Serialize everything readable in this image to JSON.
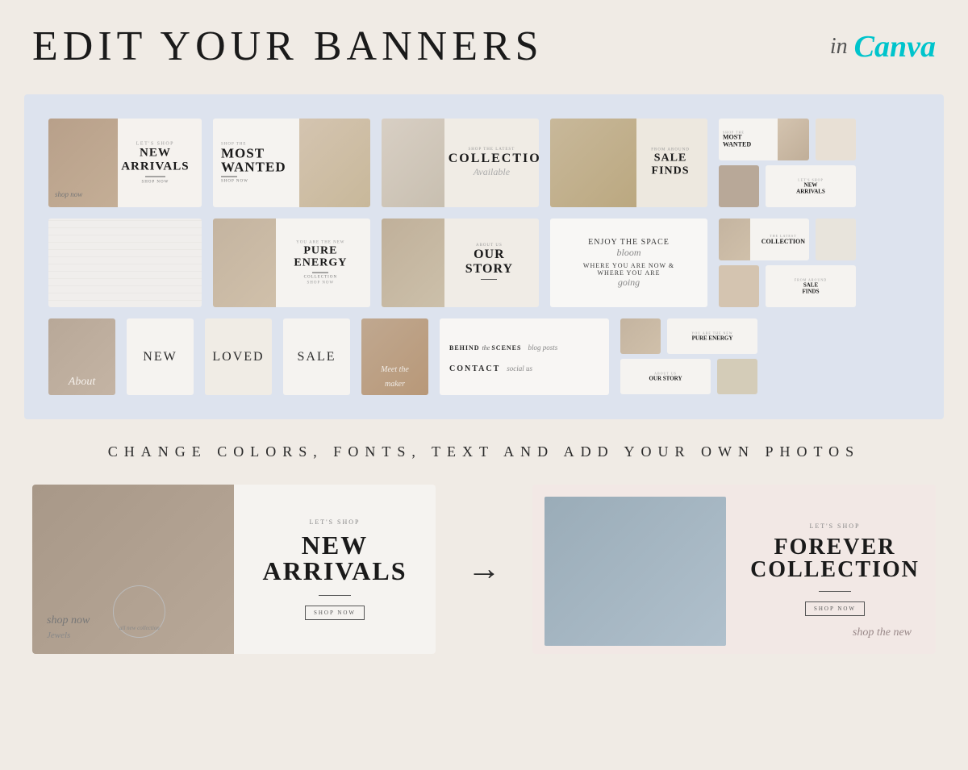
{
  "header": {
    "title": "EDIT YOUR BANNERS",
    "in_text": "in",
    "canva_text": "Canva"
  },
  "grid": {
    "row1": [
      {
        "id": "new-arrivals",
        "type": "wide",
        "text": "NEW ARRIVALS",
        "small": "LET'S SHOP",
        "sub": "SHOP NOW",
        "bg": "warm",
        "hasPhoto": true
      },
      {
        "id": "most-wanted",
        "type": "wide",
        "text": "MOST WANTED",
        "small": "SHOP THE",
        "sub": "SHOP NOW",
        "bg": "light",
        "hasPhoto": true
      },
      {
        "id": "collection",
        "type": "wide",
        "text": "COLLECTION",
        "small": "SHOP THE LATEST",
        "sub": "",
        "bg": "beige",
        "hasPhoto": true
      },
      {
        "id": "sale-finds",
        "type": "wide",
        "text": "SALE FINDS",
        "small": "FROM AROUND",
        "sub": "",
        "bg": "warm2",
        "hasPhoto": true
      },
      {
        "id": "col-right1",
        "type": "col2",
        "items": [
          {
            "text": "MOST WANTED",
            "small": "SHOP THE"
          },
          {
            "text": "NEW ARRIVALS",
            "small": "LET'S SHOP"
          }
        ]
      }
    ],
    "row2": [
      {
        "id": "blank-white",
        "type": "wide",
        "text": "",
        "bg": "white"
      },
      {
        "id": "pure-energy",
        "type": "wide",
        "text": "PURE ENERGY",
        "small": "YOU ARE THE NEW",
        "sub": "COLLECTION",
        "bg": "light",
        "hasPhoto": true
      },
      {
        "id": "our-story",
        "type": "wide",
        "text": "OUR STORY",
        "small": "ABOUT US",
        "sub": "",
        "bg": "warm",
        "hasPhoto": true
      },
      {
        "id": "enjoy-space",
        "type": "wide",
        "text": "ENJOY THE SPACE",
        "small": "bloom",
        "sub": "WHERE YOU ARE GOING",
        "bg": "white"
      },
      {
        "id": "col-right2",
        "type": "col2",
        "items": [
          {
            "text": "COLLECTION",
            "small": "THE LATEST"
          },
          {
            "text": "SALE FINDS",
            "small": "FROM AROUND"
          }
        ]
      }
    ],
    "row3": [
      {
        "id": "about",
        "type": "square-lg",
        "text": "About",
        "script": true,
        "bg": "warm"
      },
      {
        "id": "new",
        "type": "square-lg",
        "text": "NEW",
        "bg": "light"
      },
      {
        "id": "loved",
        "type": "square-lg",
        "text": "LOVED",
        "bg": "beige"
      },
      {
        "id": "sale",
        "type": "square-lg",
        "text": "SALE",
        "bg": "light"
      },
      {
        "id": "meet-maker",
        "type": "square-lg",
        "text": "Meet the maker",
        "script": true,
        "bg": "warm",
        "hasPhoto": true
      },
      {
        "id": "behind-scenes",
        "type": "wide-sm",
        "text1": "BEHIND the Scenes",
        "text2": "CONTACT",
        "sub1": "blog posts",
        "sub2": "social us"
      },
      {
        "id": "col-right3",
        "type": "col2",
        "items": [
          {
            "text": "PURE ENERGY",
            "small": "YOU ARE THE NEW"
          },
          {
            "text": "OUR STORY",
            "small": "ABOUT US"
          }
        ]
      }
    ]
  },
  "subtitle": "CHANGE COLORS, FONTS, TEXT AND ADD YOUR OWN PHOTOS",
  "preview": {
    "before": {
      "small": "LET'S SHOP",
      "main": "NEW\nARRIVALS",
      "btn": "SHOP NOW",
      "script1": "shop now",
      "script2": "all new collection"
    },
    "arrow": "→",
    "after": {
      "small": "LET'S SHOP",
      "main": "FOREVER\nCOLLECTION",
      "btn": "SHOP NOW",
      "script": "shop the new"
    }
  }
}
